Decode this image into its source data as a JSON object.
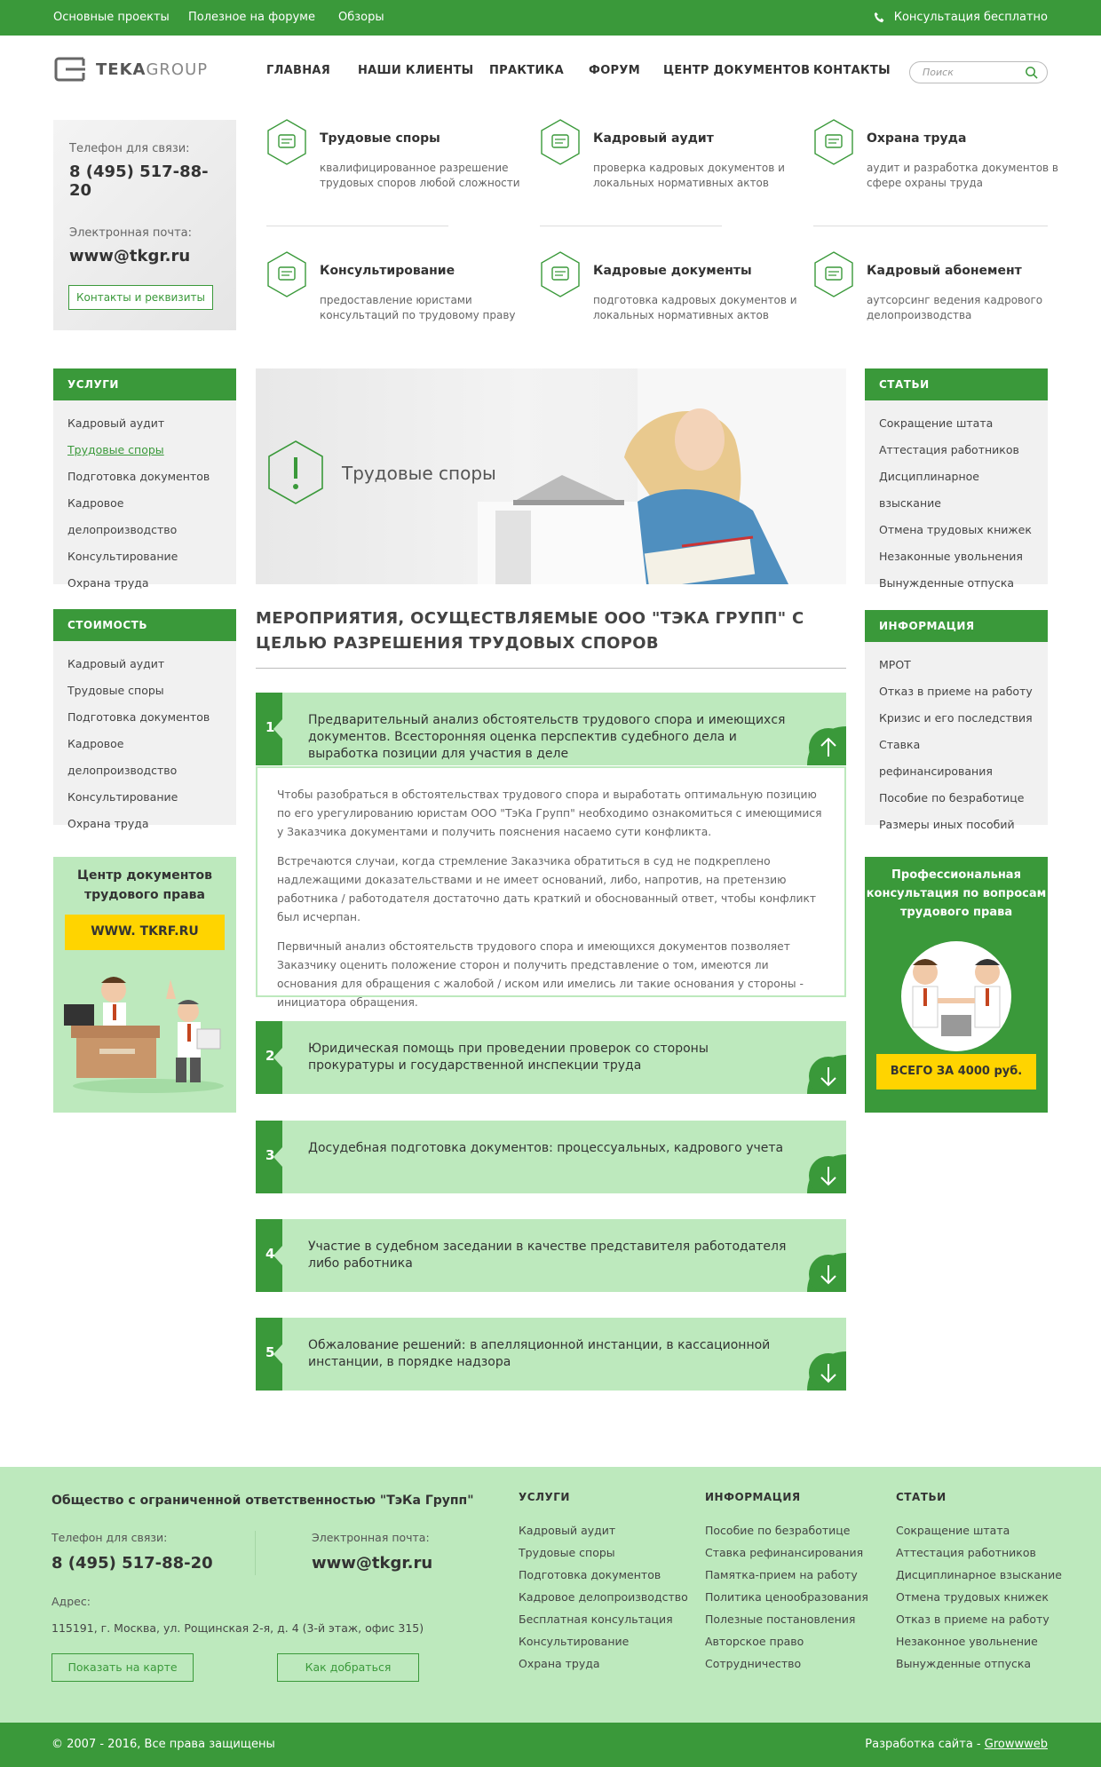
{
  "topbar": {
    "links": [
      "Основные проекты",
      "Полезное на форуме",
      "Обзоры"
    ],
    "consult": "Консультация бесплатно"
  },
  "logo": {
    "part1": "TEKA",
    "part2": "GROUP"
  },
  "nav": [
    "ГЛАВНАЯ",
    "НАШИ КЛИЕНТЫ",
    "ПРАКТИКА",
    "ФОРУМ",
    "ЦЕНТР ДОКУМЕНТОВ",
    "КОНТАКТЫ"
  ],
  "search": {
    "placeholder": "Поиск"
  },
  "contact": {
    "phone_label": "Телефон для связи:",
    "phone": "8 (495) 517-88-20",
    "email_label": "Электронная почта:",
    "email": "www@tkgr.ru",
    "button": "Контакты и реквизиты"
  },
  "services": [
    {
      "title": "Трудовые споры",
      "desc": "квалифицированное разрешение трудовых споров любой сложности",
      "icon": "megaphone-icon"
    },
    {
      "title": "Кадровый аудит",
      "desc": "проверка кадровых документов и локальных нормативных актов",
      "icon": "glasses-icon"
    },
    {
      "title": "Охрана труда",
      "desc": "аудит и разработка документов в сфере охраны труда",
      "icon": "tools-icon"
    },
    {
      "title": "Консультирование",
      "desc": "предоставление юристами консультаций по трудовому праву",
      "icon": "chat-icon"
    },
    {
      "title": "Кадровые документы",
      "desc": "подготовка кадровых документов и локальных нормативных актов",
      "icon": "document-icon"
    },
    {
      "title": "Кадровый абонемент",
      "desc": "аутсорсинг ведения кадрового делопроизводства",
      "icon": "briefcase-icon"
    }
  ],
  "left_panels": [
    {
      "title": "УСЛУГИ",
      "items": [
        "Кадровый аудит",
        "Трудовые споры",
        "Подготовка документов",
        "Кадровое делопроизводство",
        "Консультирование",
        "Охрана труда"
      ],
      "active": 1
    },
    {
      "title": "СТОИМОСТЬ",
      "items": [
        "Кадровый аудит",
        "Трудовые споры",
        "Подготовка документов",
        "Кадровое делопроизводство",
        "Консультирование",
        "Охрана труда"
      ]
    }
  ],
  "right_panels": [
    {
      "title": "СТАТЬИ",
      "items": [
        "Сокращение штата",
        "Аттестация работников",
        "Дисциплинарное взыскание",
        "Отмена трудовых книжек",
        "Незаконные увольнения",
        "Вынужденные отпуска"
      ]
    },
    {
      "title": "ИНФОРМАЦИЯ",
      "items": [
        "МРОТ",
        "Отказ в приеме на работу",
        "Кризис и его последствия",
        "Ставка рефинансирования",
        "Пособие по безработице",
        "Размеры иных пособий"
      ]
    }
  ],
  "hero": {
    "title": "Трудовые споры"
  },
  "heading": "МЕРОПРИЯТИЯ, ОСУЩЕСТВЛЯЕМЫЕ ООО \"ТЭКА ГРУПП\" С ЦЕЛЬЮ РАЗРЕШЕНИЯ ТРУДОВЫХ СПОРОВ",
  "steps": [
    {
      "num": "1",
      "text": "Предварительный анализ обстоятельств трудового спора и имеющихся документов. Всесторонняя оценка перспектив судебного дела и выработка позиции для участия в деле"
    },
    {
      "num": "2",
      "text": "Юридическая помощь при проведении проверок со стороны прокуратуры и государственной инспекции труда"
    },
    {
      "num": "3",
      "text": "Досудебная подготовка документов: процессуальных, кадрового учета"
    },
    {
      "num": "4",
      "text": "Участие в судебном заседании в качестве представителя работодателя либо работника"
    },
    {
      "num": "5",
      "text": "Обжалование решений: в апелляционной инстанции, в кассационной инстанции, в порядке надзора"
    }
  ],
  "expanded": [
    "Чтобы разобраться в обстоятельствах трудового спора и выработать оптимальную позицию по его урегулированию юристам ООО \"ТэКа Групп\" необходимо ознакомиться с имеющимися у Заказчика документами и получить пояснения насаемо сути конфликта.",
    "Встречаются случаи, когда стремление Заказчика обратиться в суд не подкреплено надлежащими доказательствами и не имеет оснований, либо, напротив, на претензию работника / работодателя достаточно дать краткий и обоснованный ответ, чтобы конфликт был исчерпан.",
    "Первичный анализ обстоятельств трудового спора и имеющихся документов позволяет Заказчику оценить положение сторон и получить представление о том, имеются ли основания для обращения с жалобой / иском или имелись ли такие основания у стороны - инициатора обращения."
  ],
  "promo_left": {
    "title": "Центр документов трудового права",
    "url": "WWW. TKRF.RU"
  },
  "promo_right": {
    "title": "Профессиональная консультация по вопросам трудового права",
    "price": "ВСЕГО ЗА 4000 руб."
  },
  "footer": {
    "company": "Общество с ограниченной ответственностью \"ТэКа Групп\"",
    "phone_label": "Телефон для связи:",
    "phone": "8 (495) 517-88-20",
    "email_label": "Электронная почта:",
    "email": "www@tkgr.ru",
    "address_label": "Адрес:",
    "address": "115191, г. Москва, ул. Рощинская 2-я, д. 4 (3-й этаж, офис 315)",
    "btn_map": "Показать на карте",
    "btn_route": "Как добраться",
    "cols": [
      {
        "title": "УСЛУГИ",
        "items": [
          "Кадровый аудит",
          "Трудовые споры",
          "Подготовка документов",
          "Кадровое делопроизводство",
          "Бесплатная консультация",
          "Консультирование",
          "Охрана труда"
        ]
      },
      {
        "title": "ИНФОРМАЦИЯ",
        "items": [
          "Пособие по безработице",
          "Ставка рефинансирования",
          "Памятка-прием на работу",
          "Политика ценообразования",
          "Полезные постановления",
          "Авторское право",
          "Сотрудничество"
        ]
      },
      {
        "title": "СТАТЬИ",
        "items": [
          "Сокращение штата",
          "Аттестация работников",
          "Дисциплинарное взыскание",
          "Отмена трудовых книжек",
          "Отказ в приеме на работу",
          "Незаконное увольнение",
          "Вынужденные отпуска"
        ]
      }
    ]
  },
  "bottom": {
    "copyright": "© 2007 - 2016, Все права защищены",
    "dev_prefix": "Разработка сайта - ",
    "dev_link": "Growwweb"
  },
  "colors": {
    "accent": "#3a993a",
    "light": "#bde9bd",
    "yellow": "#ffd400"
  }
}
